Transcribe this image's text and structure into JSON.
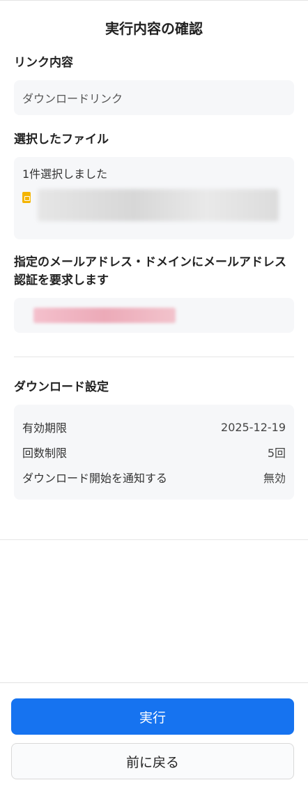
{
  "header": {
    "title": "実行内容の確認"
  },
  "link": {
    "label": "リンク内容",
    "value": "ダウンロードリンク"
  },
  "files": {
    "label": "選択したファイル",
    "count_text": "1件選択しました",
    "file_icon": "slides-file-icon"
  },
  "auth": {
    "label": "指定のメールアドレス・ドメインにメールアドレス認証を要求します"
  },
  "download_settings": {
    "label": "ダウンロード設定",
    "rows": [
      {
        "key": "有効期限",
        "value": "2025-12-19"
      },
      {
        "key": "回数制限",
        "value": "5回"
      },
      {
        "key": "ダウンロード開始を通知する",
        "value": "無効"
      }
    ]
  },
  "footer": {
    "execute_label": "実行",
    "back_label": "前に戻る"
  },
  "colors": {
    "primary": "#1673f0",
    "file_icon": "#f4b400",
    "box_bg": "#f6f7f9"
  }
}
